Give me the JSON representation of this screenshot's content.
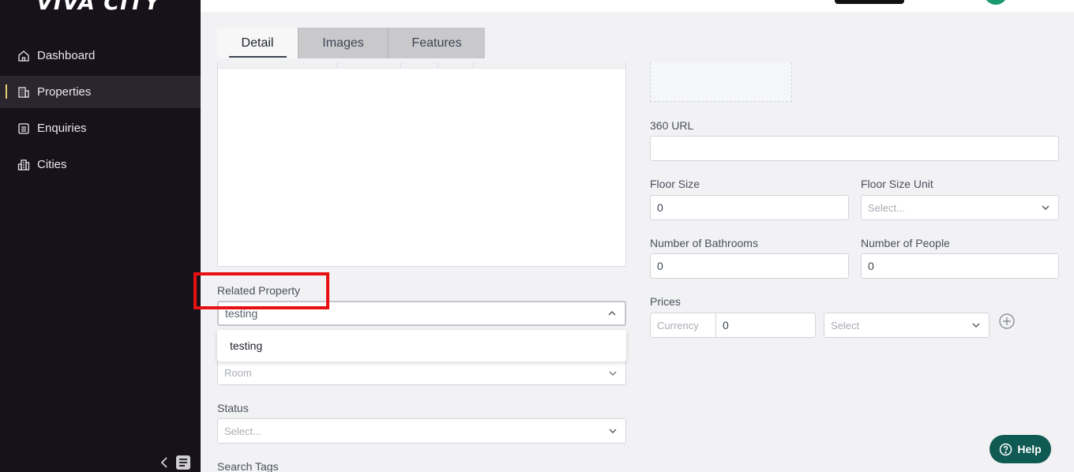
{
  "app": {
    "logo": "VIVA CITY"
  },
  "sidebar": {
    "items": [
      {
        "label": "Dashboard",
        "icon": "home-icon"
      },
      {
        "label": "Properties",
        "icon": "building-icon",
        "active": true
      },
      {
        "label": "Enquiries",
        "icon": "list-icon"
      },
      {
        "label": "Cities",
        "icon": "city-icon"
      }
    ]
  },
  "tabs": [
    {
      "label": "Detail",
      "active": true
    },
    {
      "label": "Images"
    },
    {
      "label": "Features"
    }
  ],
  "form": {
    "related_property": {
      "label": "Related Property",
      "value": "testing"
    },
    "related_dropdown_option": "testing",
    "room": {
      "placeholder": "Room"
    },
    "status": {
      "label": "Status",
      "placeholder": "Select..."
    },
    "search_tags": {
      "label": "Search Tags"
    },
    "url_360": {
      "label": "360 URL",
      "value": ""
    },
    "floor_size": {
      "label": "Floor Size",
      "value": "0"
    },
    "floor_size_unit": {
      "label": "Floor Size Unit",
      "placeholder": "Select..."
    },
    "bathrooms": {
      "label": "Number of Bathrooms",
      "value": "0"
    },
    "people": {
      "label": "Number of People",
      "value": "0"
    },
    "prices": {
      "label": "Prices",
      "currency_placeholder": "Currency",
      "amount": "0",
      "select_placeholder": "Select"
    }
  },
  "help": {
    "label": "Help"
  },
  "colors": {
    "sidebar_bg": "#17121a",
    "help_bg": "#0f5a52",
    "highlight": "#e81010",
    "active_indicator": "#e3d16a"
  }
}
